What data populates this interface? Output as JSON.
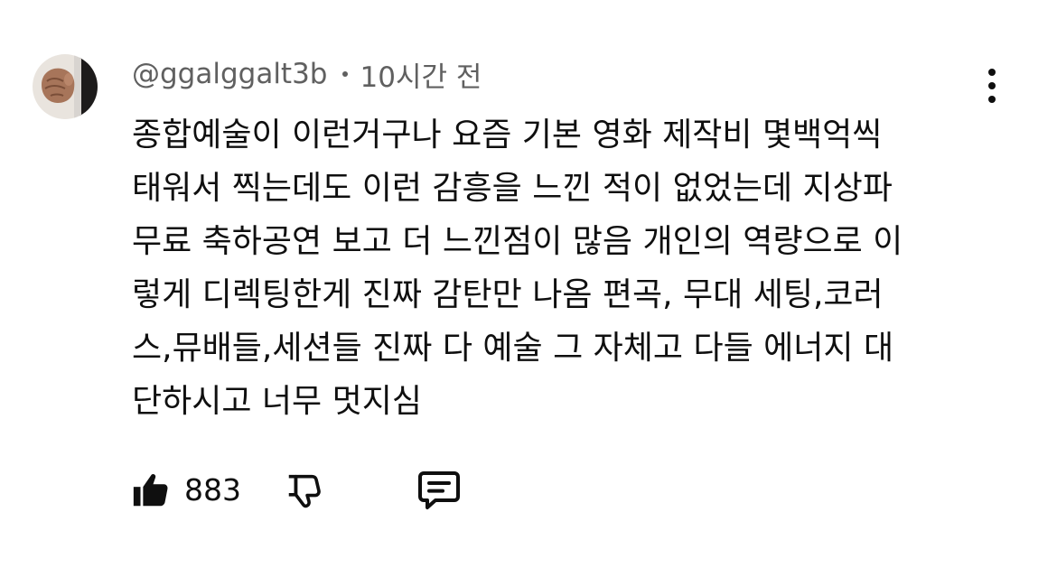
{
  "comment": {
    "author": "@ggalggalt3b",
    "time": "10시간 전",
    "lines": [
      "종합예술이 이런거구나 요즘 기본 영화 제작비 몇백억씩",
      "태워서 찍는데도 이런 감흥을 느낀 적이 없었는데 지상파",
      "무료 축하공연 보고 더 느낀점이 많음 개인의 역량으로 이",
      "렇게 디렉팅한게 진짜 감탄만 나옴 편곡, 무대 세팅,코러",
      "스,뮤배들,세션들 진짜 다 예술 그 자체고 다들 에너지 대",
      "단하시고 너무 멋지심"
    ],
    "like_count": "883"
  },
  "icons": {
    "avatar": "avatar-fist-icon",
    "more": "more-vertical-icon",
    "like": "thumbs-up-filled-icon",
    "dislike": "thumbs-down-outline-icon",
    "reply": "reply-comment-icon"
  },
  "colors": {
    "text": "#0f0f0f",
    "meta": "#606060",
    "background": "#ffffff"
  }
}
